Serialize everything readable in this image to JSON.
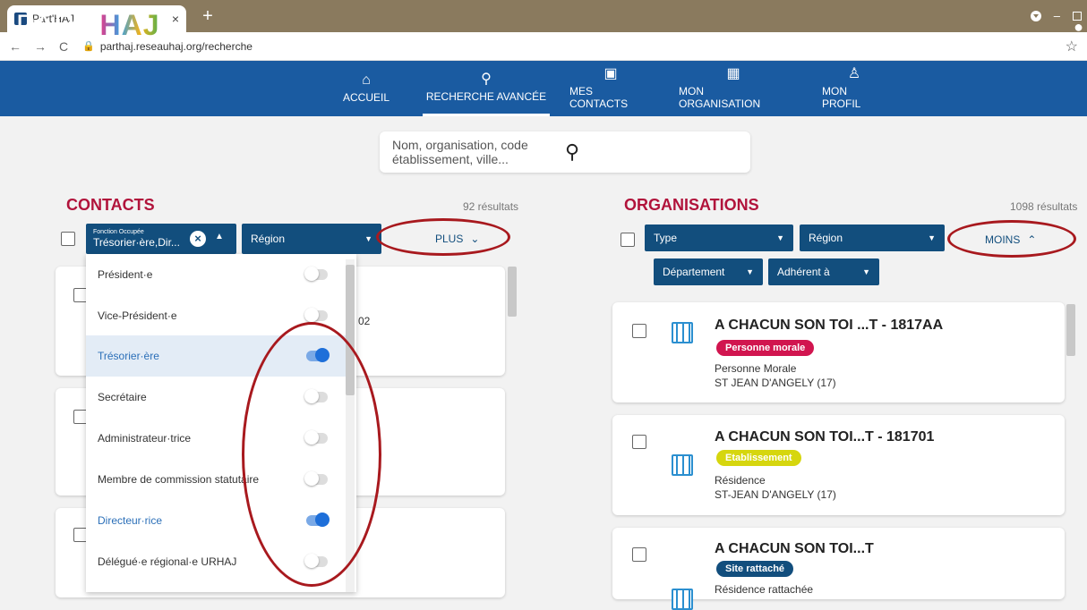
{
  "browser": {
    "tab_title": "Part'HAJ",
    "tab_close": "×",
    "new_tab": "+",
    "url": "parthaj.reseauhaj.org/recherche"
  },
  "header": {
    "logo_part": "PART'",
    "logo_haj": "HAJ",
    "menu": [
      {
        "label": "ACCUEIL",
        "icon": "home-icon"
      },
      {
        "label": "RECHERCHE AVANCÉE",
        "icon": "search-icon"
      },
      {
        "label": "MES CONTACTS",
        "icon": "contact-card-icon"
      },
      {
        "label": "MON ORGANISATION",
        "icon": "buildings-icon"
      },
      {
        "label": "MON PROFIL",
        "icon": "user-icon"
      }
    ]
  },
  "search": {
    "placeholder": "Nom, organisation, code établissement, ville..."
  },
  "contacts": {
    "title": "CONTACTS",
    "count": "92 résultats",
    "filter_fonction_small": "Fonction Occupée",
    "filter_fonction_value": "Trésorier·ère,Dir...",
    "filter_region": "Région",
    "more": "PLUS",
    "card_partial": "02",
    "options": [
      {
        "label": "Président·e",
        "on": false
      },
      {
        "label": "Vice-Président·e",
        "on": false
      },
      {
        "label": "Trésorier·ère",
        "on": true
      },
      {
        "label": "Secrétaire",
        "on": false
      },
      {
        "label": "Administrateur·trice",
        "on": false
      },
      {
        "label": "Membre de commission statutaire",
        "on": false
      },
      {
        "label": "Directeur·rice",
        "on": true
      },
      {
        "label": "Délégué·e régional·e URHAJ",
        "on": false
      }
    ]
  },
  "organisations": {
    "title": "ORGANISATIONS",
    "count": "1098 résultats",
    "filter_type": "Type",
    "filter_region": "Région",
    "less": "MOINS",
    "filter_departement": "Département",
    "filter_adherent": "Adhérent à",
    "results": [
      {
        "name": "A CHACUN SON TOI ...T - 1817AA",
        "badge": "Personne morale",
        "badge_color": "#d1154f",
        "line1": "Personne Morale",
        "line2": "ST JEAN D'ANGELY (17)"
      },
      {
        "name": "A CHACUN SON TOI...T - 181701",
        "badge": "Etablissement",
        "badge_color": "#d6d60e",
        "line1": "Résidence",
        "line2": "ST-JEAN D'ANGELY (17)"
      },
      {
        "name": "A CHACUN SON TOI...T",
        "badge": "Site rattaché",
        "badge_color": "#124e7d",
        "line1": "Résidence rattachée",
        "line2": ""
      }
    ]
  }
}
